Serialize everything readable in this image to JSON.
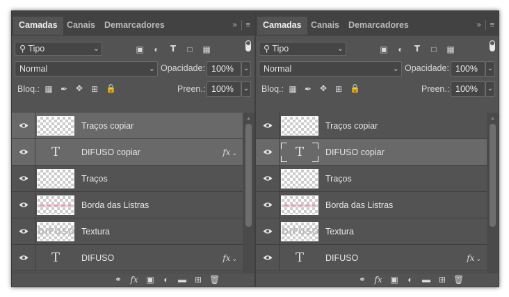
{
  "panels": [
    {
      "id": "left",
      "tabs": [
        {
          "label": "Camadas",
          "active": true
        },
        {
          "label": "Canais",
          "active": false
        },
        {
          "label": "Demarcadores",
          "active": false
        }
      ],
      "filter_label": "Tipo",
      "blend_mode": "Normal",
      "opacity_label": "Opacidade:",
      "opacity_value": "100%",
      "lock_label": "Bloq.:",
      "fill_label": "Preen.:",
      "fill_value": "100%",
      "layers": [
        {
          "name": "Traços copiar",
          "kind": "raster",
          "selected": true,
          "fx": false
        },
        {
          "name": "DIFUSO copiar",
          "kind": "text",
          "selected": true,
          "fx": true
        },
        {
          "name": "Traços",
          "kind": "raster",
          "selected": false,
          "fx": false
        },
        {
          "name": "Borda das Listras",
          "kind": "stripes",
          "selected": false,
          "fx": false
        },
        {
          "name": "Textura",
          "kind": "texture",
          "selected": false,
          "fx": false,
          "thumb_text": "DIFUSO"
        },
        {
          "name": "DIFUSO",
          "kind": "text",
          "selected": false,
          "fx": true
        }
      ]
    },
    {
      "id": "right",
      "tabs": [
        {
          "label": "Camadas",
          "active": true
        },
        {
          "label": "Canais",
          "active": false
        },
        {
          "label": "Demarcadores",
          "active": false
        }
      ],
      "filter_label": "Tipo",
      "blend_mode": "Normal",
      "opacity_label": "Opacidade:",
      "opacity_value": "100%",
      "lock_label": "Bloq.:",
      "fill_label": "Preen.:",
      "fill_value": "100%",
      "layers": [
        {
          "name": "Traços copiar",
          "kind": "raster",
          "selected": false,
          "fx": false
        },
        {
          "name": "DIFUSO copiar",
          "kind": "text-framed",
          "selected": true,
          "fx": false
        },
        {
          "name": "Traços",
          "kind": "raster",
          "selected": false,
          "fx": false
        },
        {
          "name": "Borda das Listras",
          "kind": "stripes",
          "selected": false,
          "fx": false
        },
        {
          "name": "Textura",
          "kind": "texture",
          "selected": false,
          "fx": false,
          "thumb_text": "DIFUSO"
        },
        {
          "name": "DIFUSO",
          "kind": "text",
          "selected": false,
          "fx": true
        }
      ]
    }
  ],
  "icons": {
    "collapse": "double-chevron-right-icon",
    "menu": "hamburger-menu-icon",
    "visibility": "eye-icon",
    "fx_glyph": "fx",
    "text_glyph": "T"
  },
  "colors": {
    "panel_bg": "#535353",
    "tabbar_bg": "#424242",
    "selected_row": "#696969",
    "text": "#e6e6e6"
  }
}
